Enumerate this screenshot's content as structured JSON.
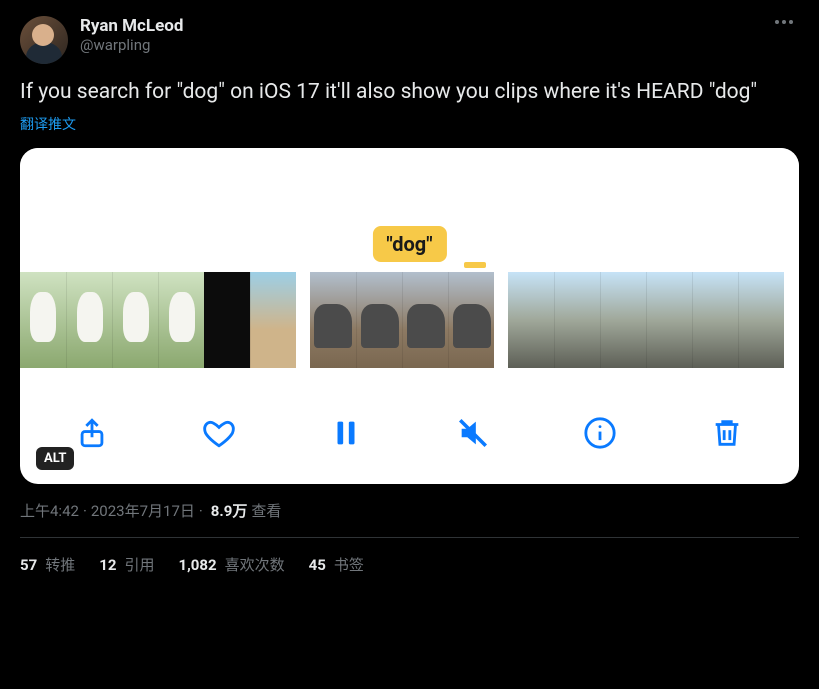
{
  "author": {
    "display_name": "Ryan McLeod",
    "handle": "@warpling"
  },
  "body": "If you search for \"dog\" on iOS 17 it'll also show you clips where it's HEARD \"dog\"",
  "translate_label": "翻译推文",
  "media": {
    "tooltip_text": "\"dog\"",
    "alt_badge": "ALT",
    "toolbar_icons": [
      "share-icon",
      "heart-icon",
      "pause-icon",
      "mute-icon",
      "info-icon",
      "trash-icon"
    ]
  },
  "meta": {
    "time": "上午4:42",
    "dot": " · ",
    "date": "2023年7月17日",
    "views_num": "8.9万",
    "views_label": "查看"
  },
  "stats": {
    "retweets_num": "57",
    "retweets_label": "转推",
    "quotes_num": "12",
    "quotes_label": "引用",
    "likes_num": "1,082",
    "likes_label": "喜欢次数",
    "bookmarks_num": "45",
    "bookmarks_label": "书签"
  }
}
